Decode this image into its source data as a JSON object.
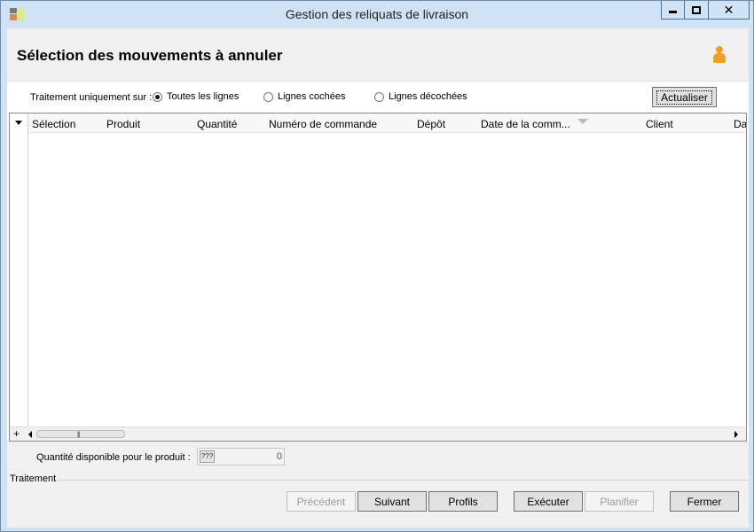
{
  "window": {
    "title": "Gestion des reliquats de livraison"
  },
  "header": {
    "title": "Sélection des mouvements à annuler"
  },
  "filter": {
    "label": "Traitement uniquement sur :",
    "options": [
      "Toutes les lignes",
      "Lignes cochées",
      "Lignes décochées"
    ],
    "selected": "Toutes les lignes",
    "refresh_label": "Actualiser"
  },
  "grid": {
    "columns": [
      "Sélection",
      "Produit",
      "Quantité",
      "Numéro de commande",
      "Dépôt",
      "Date de la comm...",
      "Client",
      "Da"
    ],
    "rows": [],
    "add_button": "+"
  },
  "quantity": {
    "label": "Quantité disponible pour le produit :",
    "badge": "???",
    "value": "0"
  },
  "treatment": {
    "legend": "Traitement",
    "buttons": {
      "previous": "Précédent",
      "next": "Suivant",
      "profiles": "Profils",
      "execute": "Exécuter",
      "schedule": "Planifier",
      "close": "Fermer"
    }
  },
  "colors": {
    "frame": "#cfe3f4",
    "accent_icon": "#f0a020"
  }
}
